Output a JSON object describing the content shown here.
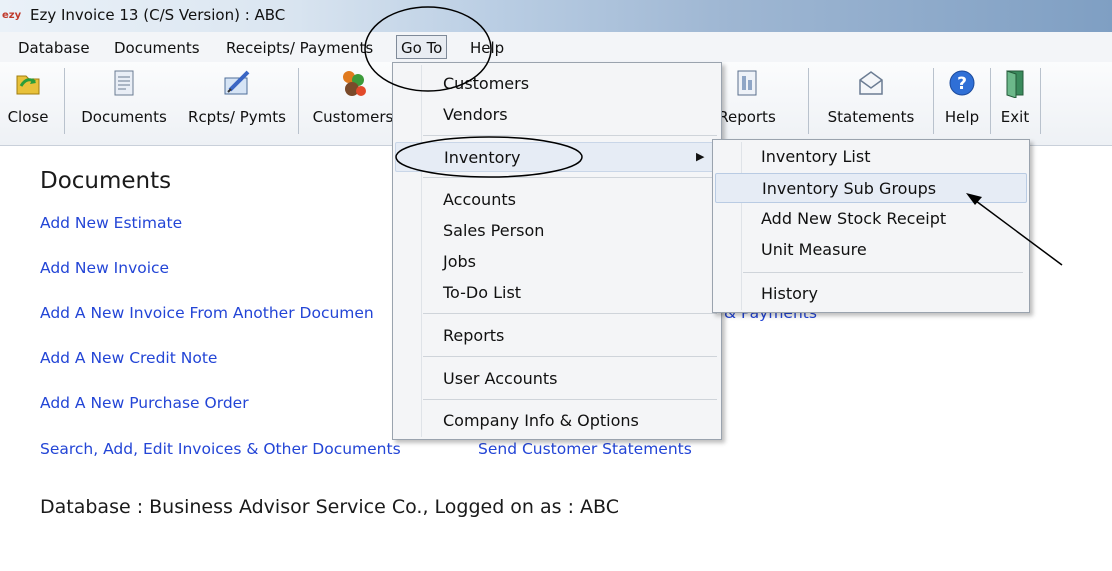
{
  "window": {
    "app_icon": "ezy",
    "title": "Ezy Invoice 13 (C/S Version) : ABC"
  },
  "menubar": {
    "database": "Database",
    "documents": "Documents",
    "receipts": "Receipts/ Payments",
    "goto": "Go To",
    "help": "Help"
  },
  "toolbar": {
    "close": {
      "label": "Close",
      "icon": "close-folder-icon"
    },
    "documents": {
      "label": "Documents",
      "icon": "document-icon"
    },
    "rcpts": {
      "label": "Rcpts/ Pymts",
      "icon": "pen-paper-icon"
    },
    "customers": {
      "label": "Customers",
      "icon": "people-icon"
    },
    "reports": {
      "label": "Reports",
      "icon": "report-icon"
    },
    "statements": {
      "label": "Statements",
      "icon": "envelope-icon"
    },
    "help": {
      "label": "Help",
      "icon": "question-icon"
    },
    "exit": {
      "label": "Exit",
      "icon": "door-exit-icon"
    }
  },
  "main": {
    "heading": "Documents",
    "links": {
      "estimate": "Add New Estimate",
      "invoice": "Add New Invoice",
      "invoice_from": "Add A New Invoice From Another Documen",
      "credit": "Add A New Credit Note",
      "purchase": "Add A New Purchase Order",
      "search": "Search, Add, Edit Invoices & Other Documents",
      "payments_partial": "& Payments",
      "statements": "Send Customer Statements"
    },
    "status": "Database : Business Advisor Service Co.,  Logged on as : ABC"
  },
  "goto_menu": {
    "customers": "Customers",
    "vendors": "Vendors",
    "inventory": "Inventory",
    "submenu_arrow": "▶",
    "accounts": "Accounts",
    "sales_person": "Sales Person",
    "jobs": "Jobs",
    "todo": "To-Do List",
    "reports": "Reports",
    "user_accounts": "User Accounts",
    "company_info": "Company Info & Options"
  },
  "inventory_submenu": {
    "list": "Inventory List",
    "sub_groups": "Inventory Sub Groups",
    "stock_receipt": "Add New Stock Receipt",
    "unit_measure": "Unit Measure",
    "history": "History"
  },
  "colors": {
    "link": "#2345d6",
    "highlight": "#e6ecf5",
    "menu_bg": "#f4f5f7"
  }
}
